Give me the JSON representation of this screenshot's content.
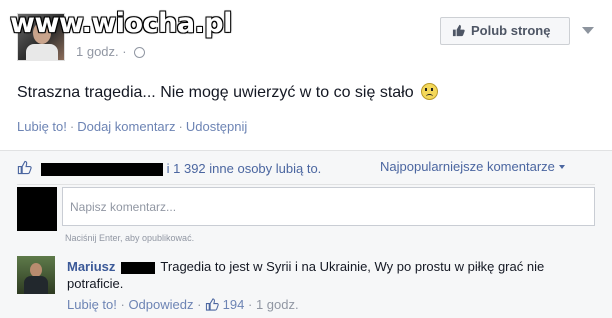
{
  "watermark": "www.wiocha.pl",
  "post": {
    "timestamp": "1 godz.",
    "like_page_label": "Polub stronę",
    "text": "Straszna tragedia... Nie mogę uwierzyć w to co się stało",
    "actions": {
      "like": "Lubię to!",
      "comment": "Dodaj komentarz",
      "share": "Udostępnij"
    }
  },
  "ufi": {
    "likes_text": "i 1 392 inne osoby lubią to.",
    "sort_label": "Najpopularniejsze komentarze",
    "comment_placeholder": "Napisz komentarz...",
    "hint": "Naciśnij Enter, aby opublikować.",
    "comment": {
      "author": "Mariusz",
      "text": "Tragedia to jest w Syrii i na Ukrainie, Wy po prostu w piłkę grać nie potraficie.",
      "like": "Lubię to!",
      "reply": "Odpowiedz",
      "like_count": "194",
      "time": "1 godz."
    }
  },
  "colors": {
    "link": "#4b66a0",
    "name": "#3b5998",
    "muted": "#9197a3",
    "background": "#f6f7f8"
  },
  "icons": [
    "thumbs-up-icon",
    "globe-icon",
    "chevron-down-icon",
    "sad-emoticon-icon"
  ]
}
